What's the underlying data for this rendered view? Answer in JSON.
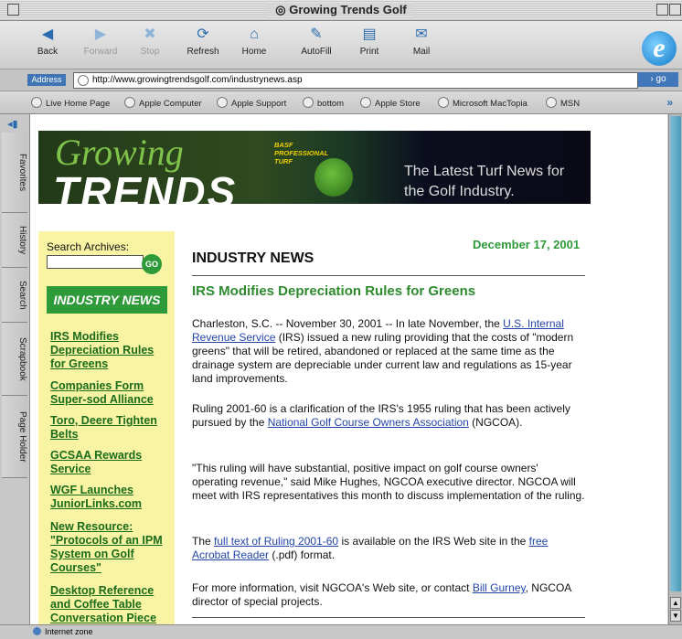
{
  "window": {
    "title": "Growing Trends Golf"
  },
  "toolbar": {
    "back": "Back",
    "forward": "Forward",
    "stop": "Stop",
    "refresh": "Refresh",
    "home": "Home",
    "autofill": "AutoFill",
    "print": "Print",
    "mail": "Mail"
  },
  "address": {
    "label": "Address",
    "url": "http://www.growingtrendsgolf.com/industrynews.asp",
    "go": "go"
  },
  "links": [
    "Live Home Page",
    "Apple Computer",
    "Apple Support",
    "bottom",
    "Apple Store",
    "Microsoft MacTopia",
    "MSN"
  ],
  "sidetabs": [
    "Favorites",
    "History",
    "Search",
    "Scrapbook",
    "Page Holder"
  ],
  "banner": {
    "logo_top": "Growing",
    "logo_bottom": "TRENDS",
    "sponsor": "BASF PROFESSIONAL TURF",
    "tagline": "The Latest Turf News for the Golf Industry."
  },
  "sidebar": {
    "search_label": "Search Archives:",
    "search_value": "",
    "go": "GO",
    "badge": "INDUSTRY NEWS",
    "items": [
      "IRS Modifies Depreciation Rules for Greens",
      "Companies Form Super-sod Alliance",
      "Toro, Deere Tighten Belts",
      "GCSAA Rewards Service",
      "WGF Launches JuniorLinks.com",
      "New Resource: \"Protocols of an IPM System on Golf Courses\"",
      "Desktop Reference and Coffee Table Conversation Piece"
    ]
  },
  "article": {
    "date": "December 17, 2001",
    "section": "INDUSTRY NEWS",
    "headline": "IRS Modifies Depreciation Rules for Greens",
    "p1_a": "Charleston, S.C. -- November 30, 2001 -- In late November, the ",
    "p1_link": "U.S. Internal Revenue Service",
    "p1_b": " (IRS) issued a new ruling providing that the costs of \"modern greens\" that will be retired, abandoned or replaced at the same time as the drainage system are depreciable under current law and regulations as 15-year land improvements.",
    "p2_a": "Ruling 2001-60 is a clarification of the IRS's 1955 ruling that has been actively pursued by the ",
    "p2_link": "National Golf Course Owners Association",
    "p2_b": " (NGCOA).",
    "p3": "\"This ruling will have substantial, positive impact on golf course owners' operating revenue,\" said Mike Hughes, NGCOA executive director. NGCOA will meet with IRS representatives this month to discuss implementation of the ruling.",
    "p4_a": "The ",
    "p4_link1": "full text of Ruling 2001-60",
    "p4_b": " is available on the IRS Web site in the ",
    "p4_link2": "free Acrobat Reader",
    "p4_c": " (.pdf) format.",
    "p5_a": "For more information, visit NGCOA's Web site, or contact ",
    "p5_link": "Bill Gurney",
    "p5_b": ", NGCOA director of special projects."
  },
  "status": {
    "zone": "Internet zone"
  }
}
